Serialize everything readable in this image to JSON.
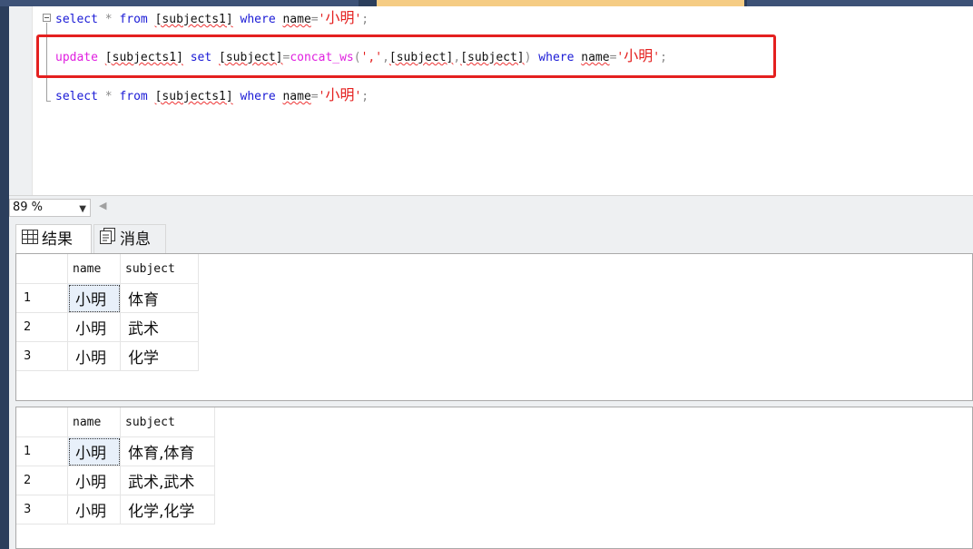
{
  "editor": {
    "line1": {
      "kw_select": "select",
      "star": "*",
      "kw_from": "from",
      "table": "[subjects1]",
      "kw_where": "where",
      "col": "name",
      "eq": "=",
      "q1": "'",
      "val": "小明",
      "q2": "'",
      "semi": ";"
    },
    "line2": {
      "kw_update": "update",
      "table": "[subjects1]",
      "kw_set": "set",
      "col": "[subject]",
      "eq": "=",
      "fn": "concat_ws",
      "paren_open": "(",
      "sep_str": "','",
      "comma1": ",",
      "arg1": "[subject]",
      "comma2": ",",
      "arg2": "[subject]",
      "paren_close": ")",
      "kw_where": "where",
      "where_col": "name",
      "eq2": "=",
      "q1": "'",
      "val": "小明",
      "q2": "'",
      "semi": ";"
    },
    "line3": {
      "kw_select": "select",
      "star": "*",
      "kw_from": "from",
      "table": "[subjects1]",
      "kw_where": "where",
      "col": "name",
      "eq": "=",
      "q1": "'",
      "val": "小明",
      "q2": "'",
      "semi": ";"
    }
  },
  "zoom": {
    "value": "89 %"
  },
  "tabs": {
    "results": "结果",
    "messages": "消息"
  },
  "grid1": {
    "columns": [
      "name",
      "subject"
    ],
    "rows": [
      {
        "n": "1",
        "name": "小明",
        "subject": "体育"
      },
      {
        "n": "2",
        "name": "小明",
        "subject": "武术"
      },
      {
        "n": "3",
        "name": "小明",
        "subject": "化学"
      }
    ]
  },
  "grid2": {
    "columns": [
      "name",
      "subject"
    ],
    "rows": [
      {
        "n": "1",
        "name": "小明",
        "subject": "体育,体育"
      },
      {
        "n": "2",
        "name": "小明",
        "subject": "武术,武术"
      },
      {
        "n": "3",
        "name": "小明",
        "subject": "化学,化学"
      }
    ]
  },
  "colors": {
    "highlight_border": "#e4201f",
    "keyword": "#1a1ad6",
    "string": "#e4201f",
    "function": "#e020e0"
  }
}
